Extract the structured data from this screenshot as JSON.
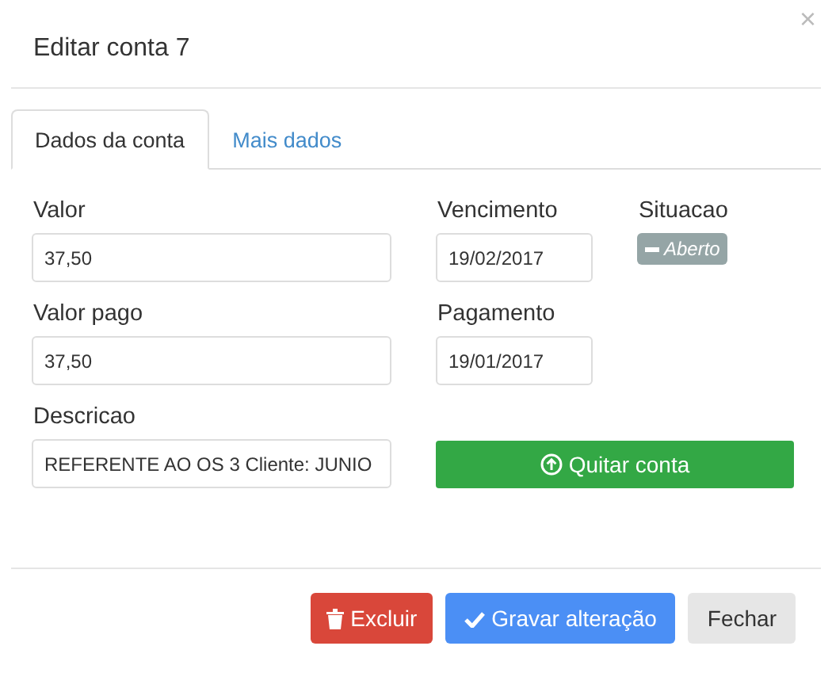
{
  "title": "Editar conta 7",
  "close": "×",
  "tabs": [
    {
      "label": "Dados da conta",
      "selected": true
    },
    {
      "label": "Mais dados",
      "selected": false
    }
  ],
  "fields": [
    {
      "label": "Valor",
      "value": "37,50"
    },
    {
      "label": "Vencimento",
      "value": "19/02/2017"
    },
    {
      "label": "Valor pago",
      "value": "37,50"
    },
    {
      "label": "Pagamento",
      "value": "19/01/2017"
    },
    {
      "label": "Descricao",
      "value": "REFERENTE AO OS 3 Cliente: JUNIO"
    }
  ],
  "status": {
    "label": "Situacao",
    "badge": "Aberto"
  },
  "pay_button": "Quitar conta",
  "buttons": [
    {
      "label": "Excluir",
      "kind": "danger"
    },
    {
      "label": "Gravar alteração",
      "kind": "primary"
    },
    {
      "label": "Fechar",
      "kind": "default"
    }
  ]
}
